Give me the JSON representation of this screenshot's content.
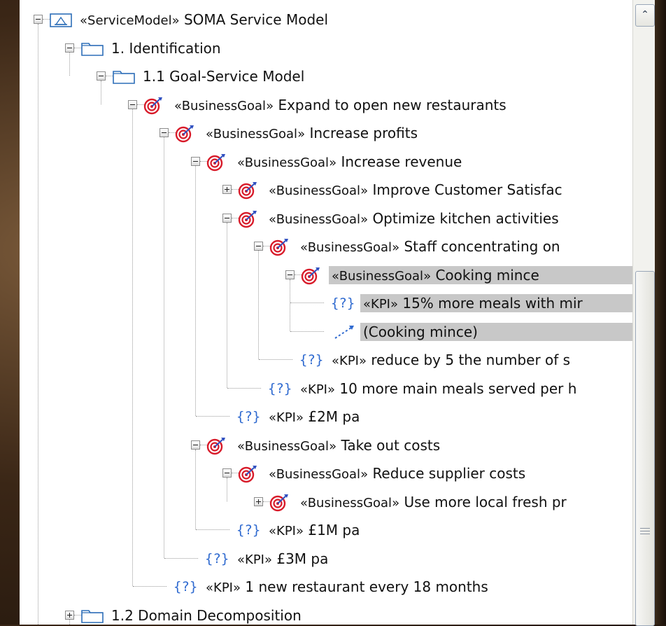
{
  "tree": {
    "nodes": [
      {
        "stereo": "«ServiceModel»",
        "text": "SOMA Service Model"
      },
      {
        "stereo": "",
        "text": "1. Identification"
      },
      {
        "stereo": "",
        "text": "1.1 Goal-Service Model"
      },
      {
        "stereo": "«BusinessGoal»",
        "text": "Expand to open new restaurants"
      },
      {
        "stereo": "«BusinessGoal»",
        "text": "Increase profits"
      },
      {
        "stereo": "«BusinessGoal»",
        "text": "Increase revenue"
      },
      {
        "stereo": "«BusinessGoal»",
        "text": "Improve Customer Satisfac"
      },
      {
        "stereo": "«BusinessGoal»",
        "text": "Optimize kitchen activities"
      },
      {
        "stereo": "«BusinessGoal»",
        "text": "Staff concentrating on"
      },
      {
        "stereo": "«BusinessGoal»",
        "text": "Cooking mince"
      },
      {
        "stereo": "«KPI»",
        "text": "15% more meals with mir"
      },
      {
        "stereo": "",
        "text": "(Cooking mince)"
      },
      {
        "stereo": "«KPI»",
        "text": "reduce by 5 the number of s"
      },
      {
        "stereo": "«KPI»",
        "text": "10 more main meals served per h"
      },
      {
        "stereo": "«KPI»",
        "text": "£2M pa"
      },
      {
        "stereo": "«BusinessGoal»",
        "text": "Take out costs"
      },
      {
        "stereo": "«BusinessGoal»",
        "text": "Reduce supplier costs"
      },
      {
        "stereo": "«BusinessGoal»",
        "text": "Use more local fresh pr"
      },
      {
        "stereo": "«KPI»",
        "text": "£1M pa"
      },
      {
        "stereo": "«KPI»",
        "text": "£3M pa"
      },
      {
        "stereo": "«KPI»",
        "text": "1 new restaurant every 18 months"
      },
      {
        "stereo": "",
        "text": "1.2 Domain Decomposition"
      }
    ]
  },
  "icons": {
    "kpi_glyph": "{?}",
    "goal": "target-icon",
    "folder": "folder-icon",
    "model": "service-model-icon",
    "relation": "dependency-arrow-icon"
  },
  "scrollbar": {
    "up_glyph": "⌃"
  },
  "colors": {
    "selection": "#c8c8c8",
    "kpi": "#2f6ad0",
    "goal_red": "#d81b2a",
    "goal_blue": "#3050c0"
  }
}
